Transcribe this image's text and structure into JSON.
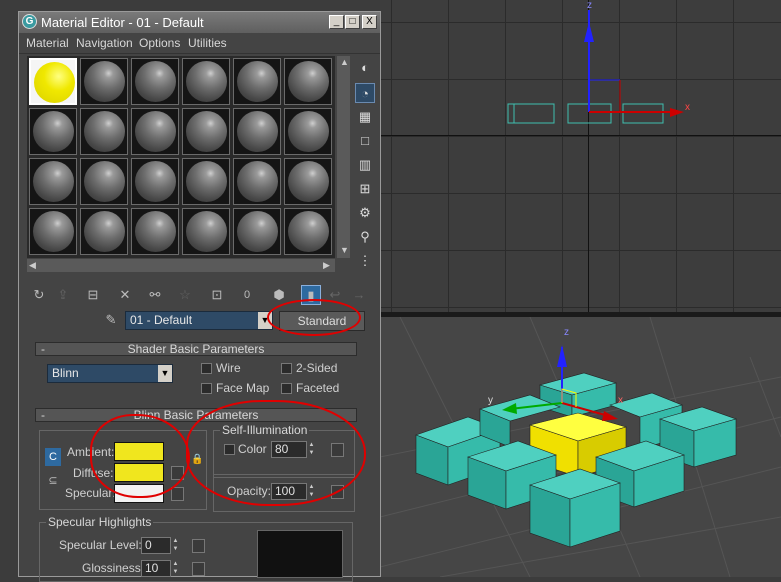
{
  "window": {
    "title": "Material Editor - 01 - Default",
    "icon": "3ds-max-app-icon",
    "controls": [
      "_",
      "□",
      "X"
    ]
  },
  "menu": [
    "Material",
    "Navigation",
    "Options",
    "Utilities"
  ],
  "slots": {
    "rows": 4,
    "cols": 6,
    "selected_index": 0
  },
  "toolbar": {
    "get_label": "0"
  },
  "material": {
    "name": "01 - Default",
    "dropdown_arrow": "▼",
    "type_button": "Standard"
  },
  "shader_rollout": {
    "minus": "-",
    "title": "Shader Basic Parameters",
    "shader": "Blinn",
    "wire": "Wire",
    "two_sided": "2-Sided",
    "face_map": "Face Map",
    "faceted": "Faceted"
  },
  "blinn_rollout": {
    "minus": "-",
    "title": "Blinn Basic Parameters",
    "ambient": "Ambient:",
    "diffuse": "Diffuse:",
    "specular": "Specular:",
    "ambient_color": "#f0e61e",
    "diffuse_color": "#f0e61e",
    "specular_color": "#f2f2f2",
    "self_illum_title": "Self-Illumination",
    "color_label": "Color",
    "color_value": "80",
    "opacity_label": "Opacity:",
    "opacity_value": "100"
  },
  "specular_highlights": {
    "title": "Specular Highlights",
    "level_label": "Specular Level:",
    "level_value": "0",
    "gloss_label": "Glossiness:",
    "gloss_value": "10"
  },
  "viewport": {
    "axis_x": "x",
    "axis_y": "y",
    "axis_z": "z"
  }
}
